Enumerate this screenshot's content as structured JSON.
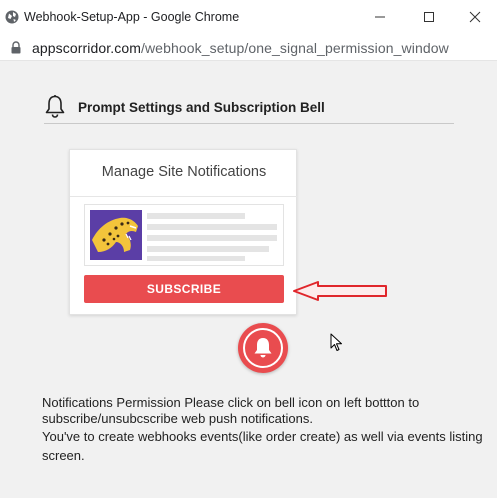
{
  "window": {
    "title": "Webhook-Setup-App - Google Chrome",
    "controls": [
      "minimize-icon",
      "maximize-icon",
      "close-icon"
    ]
  },
  "address_bar": {
    "icon": "lock-icon",
    "domain": "appscorridor.com",
    "path": "/webhook_setup/one_signal_permission_window"
  },
  "section": {
    "icon": "bell-icon",
    "heading": "Prompt Settings and Subscription Bell"
  },
  "prompt_card": {
    "title": "Manage Site Notifications",
    "subscribe_label": "SUBSCRIBE",
    "accent_color": "#e94c4f"
  },
  "notification_bell": {
    "icon": "bell-icon",
    "color": "#e94c4f"
  },
  "info": {
    "line1": "Notifications Permission Please click on bell icon on left bottton to subscribe/unsubcscribe web push notifications.",
    "line2": "You've to create webhooks events(like order create) as well via events listing screen."
  }
}
